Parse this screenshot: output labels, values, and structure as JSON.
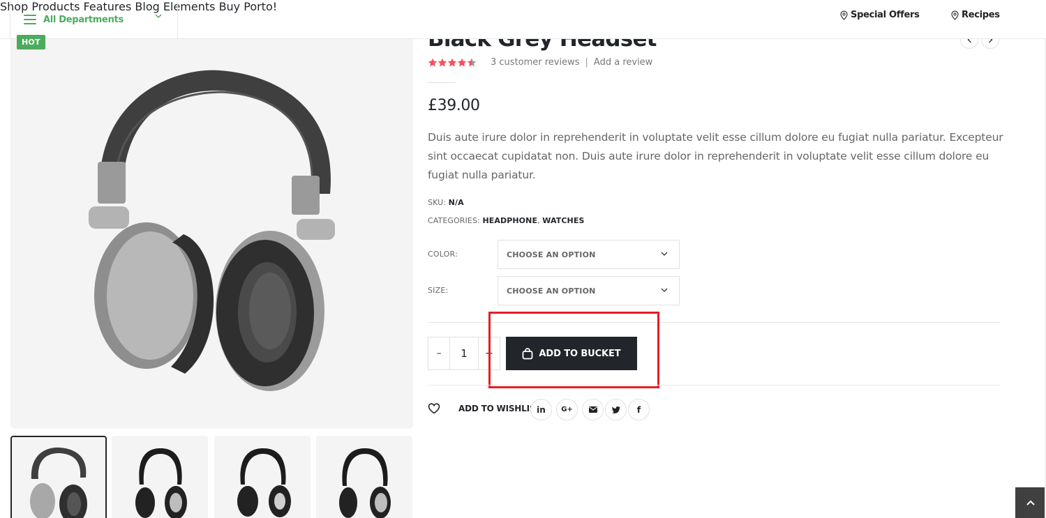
{
  "header": {
    "departments_label": "All Departments",
    "nav": [
      "Shop",
      "Products",
      "Features",
      "Blog",
      "Elements",
      "Buy Porto!"
    ],
    "special_offers": "Special Offers",
    "recipes": "Recipes"
  },
  "gallery": {
    "badge": "HOT",
    "thumbnail_count": 4
  },
  "product": {
    "title": "Black Grey Headset",
    "rating": 4.5,
    "rating_max": 5,
    "reviews_text": "3 customer reviews",
    "reviews_sep": "|",
    "add_review": "Add a review",
    "price": "£39.00",
    "description": "Duis aute irure dolor in reprehenderit in voluptate velit esse cillum dolore eu fugiat nulla pariatur. Excepteur sint occaecat cupidatat non. Duis aute irure dolor in reprehenderit in voluptate velit esse cillum dolore eu fugiat nulla pariatur.",
    "sku_label": "SKU:",
    "sku_value": "N/A",
    "categories_label": "CATEGORIES:",
    "categories": [
      "HEADPHONE",
      "WATCHES"
    ],
    "category_separator": ",",
    "color_label": "COLOR:",
    "size_label": "SIZE:",
    "color_select": "CHOOSE AN OPTION",
    "size_select": "CHOOSE AN OPTION",
    "quantity": "1",
    "qty_minus": "–",
    "qty_plus": "+",
    "add_to_cart": "ADD TO BUCKET",
    "wishlist": "ADD TO WISHLIST",
    "social": [
      "in",
      "G+",
      "email",
      "twitter",
      "f"
    ]
  },
  "colors": {
    "accent_green": "#4dab5d",
    "dark": "#222529",
    "star": "#f5525e",
    "highlight_red": "#e31e24"
  }
}
